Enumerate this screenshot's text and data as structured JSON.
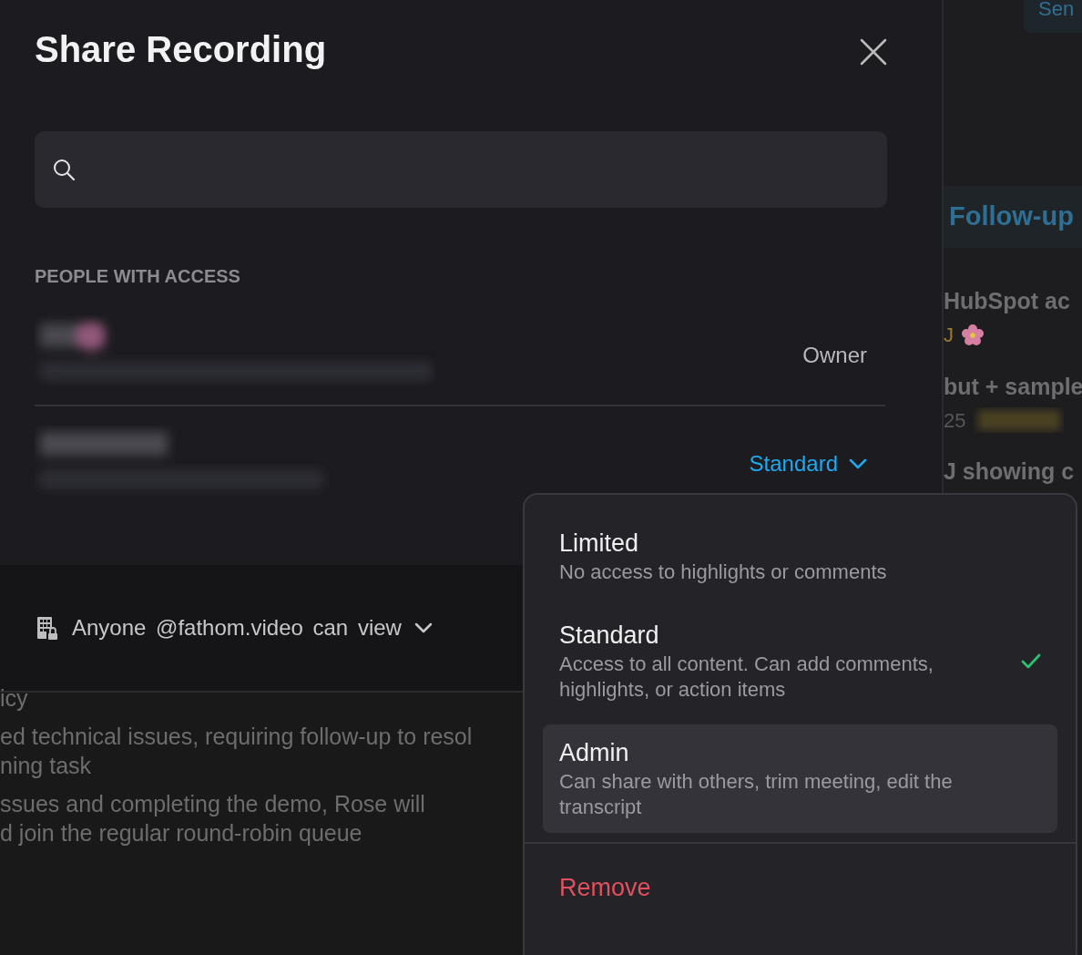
{
  "dialog": {
    "title": "Share Recording",
    "section_label": "PEOPLE WITH ACCESS",
    "people": [
      {
        "role": "Owner",
        "kind": "static"
      },
      {
        "role": "Standard",
        "kind": "dropdown"
      }
    ],
    "general_access": {
      "audience": "Anyone",
      "domain": "@fathom.video",
      "permission": "can view"
    }
  },
  "role_menu": {
    "options": [
      {
        "label": "Limited",
        "description": "No access to highlights or comments",
        "selected": false,
        "highlighted": false
      },
      {
        "label": "Standard",
        "description": "Access to all content. Can add comments, highlights, or action items",
        "selected": true,
        "highlighted": false
      },
      {
        "label": "Admin",
        "description": "Can share with others, trim meeting, edit the transcript",
        "selected": false,
        "highlighted": true
      }
    ],
    "remove_label": "Remove"
  },
  "background": {
    "side_items": [
      {
        "kind": "chip",
        "text": "Sen"
      },
      {
        "kind": "heading",
        "text": "Follow-up"
      },
      {
        "kind": "title",
        "text": "HubSpot ac"
      },
      {
        "kind": "meta",
        "text": "J"
      },
      {
        "kind": "title",
        "text": "but + sample"
      },
      {
        "kind": "meta",
        "text": "25"
      },
      {
        "kind": "title",
        "text": "J showing c"
      }
    ],
    "lines": [
      "icy",
      "ed technical issues, requiring follow-up to resol",
      "ning task",
      "ssues and completing the demo, Rose will",
      "d join the regular round-robin queue"
    ]
  }
}
